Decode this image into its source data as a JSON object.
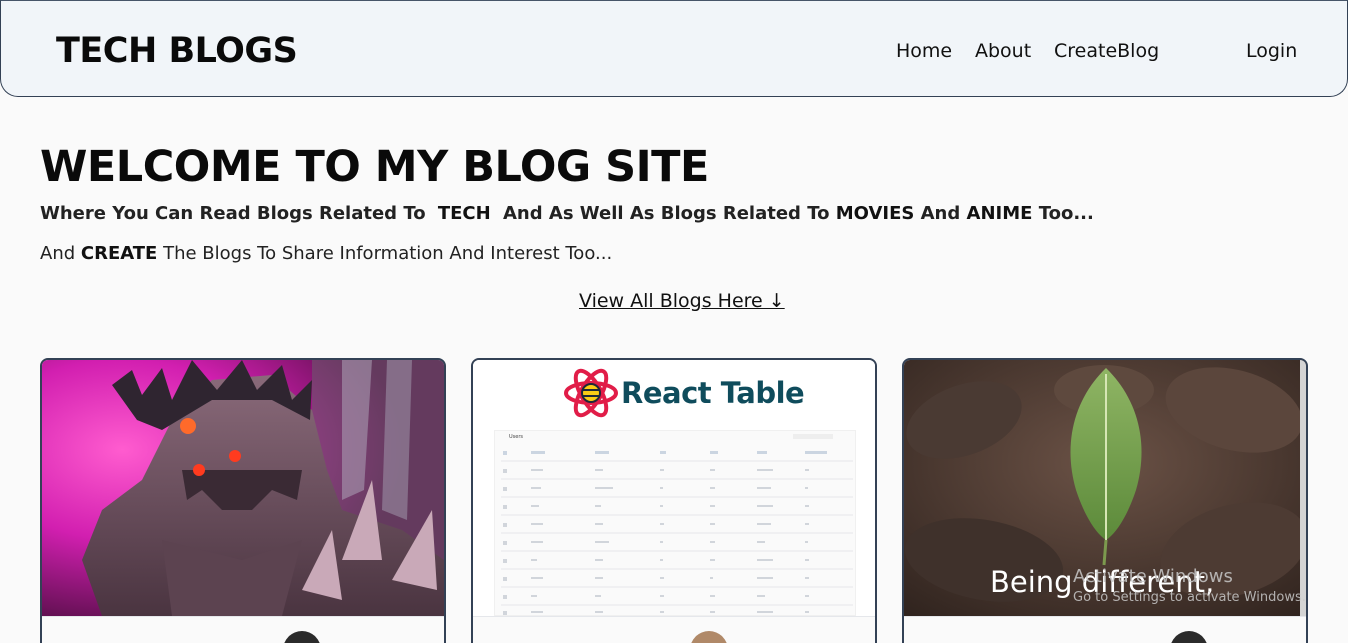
{
  "navbar": {
    "brand": "TECH BLOGS",
    "links": [
      "Home",
      "About",
      "CreateBlog"
    ],
    "login": "Login"
  },
  "hero": {
    "title": "WELCOME TO MY BLOG SITE",
    "line1": {
      "a": "Where You Can Read Blogs Related To ",
      "b": "TECH",
      "c": " And As Well As Blogs Related To ",
      "d": "MOVIES",
      "e": " And ",
      "f": "ANIME",
      "g": " Too..."
    },
    "line2": {
      "a": "And ",
      "b": "CREATE",
      "c": " The Blogs To Share Information And Interest Too..."
    },
    "view_all": "View All Blogs Here ↓"
  },
  "cards": [
    {
      "image": "anime-character-image"
    },
    {
      "image": "react-table-image",
      "logo_text": "React Table",
      "table_title": "Users"
    },
    {
      "image": "leaf-image",
      "caption": "Being different,"
    }
  ],
  "os_watermark": {
    "line1": "Activate Windows",
    "line2": "Go to Settings to activate Windows."
  },
  "colors": {
    "navbar_bg": "#f1f5f9",
    "border": "#334155",
    "page_bg": "#fafafa",
    "react_table_text": "#0f4c5c",
    "react_logo": "#e11d48"
  }
}
